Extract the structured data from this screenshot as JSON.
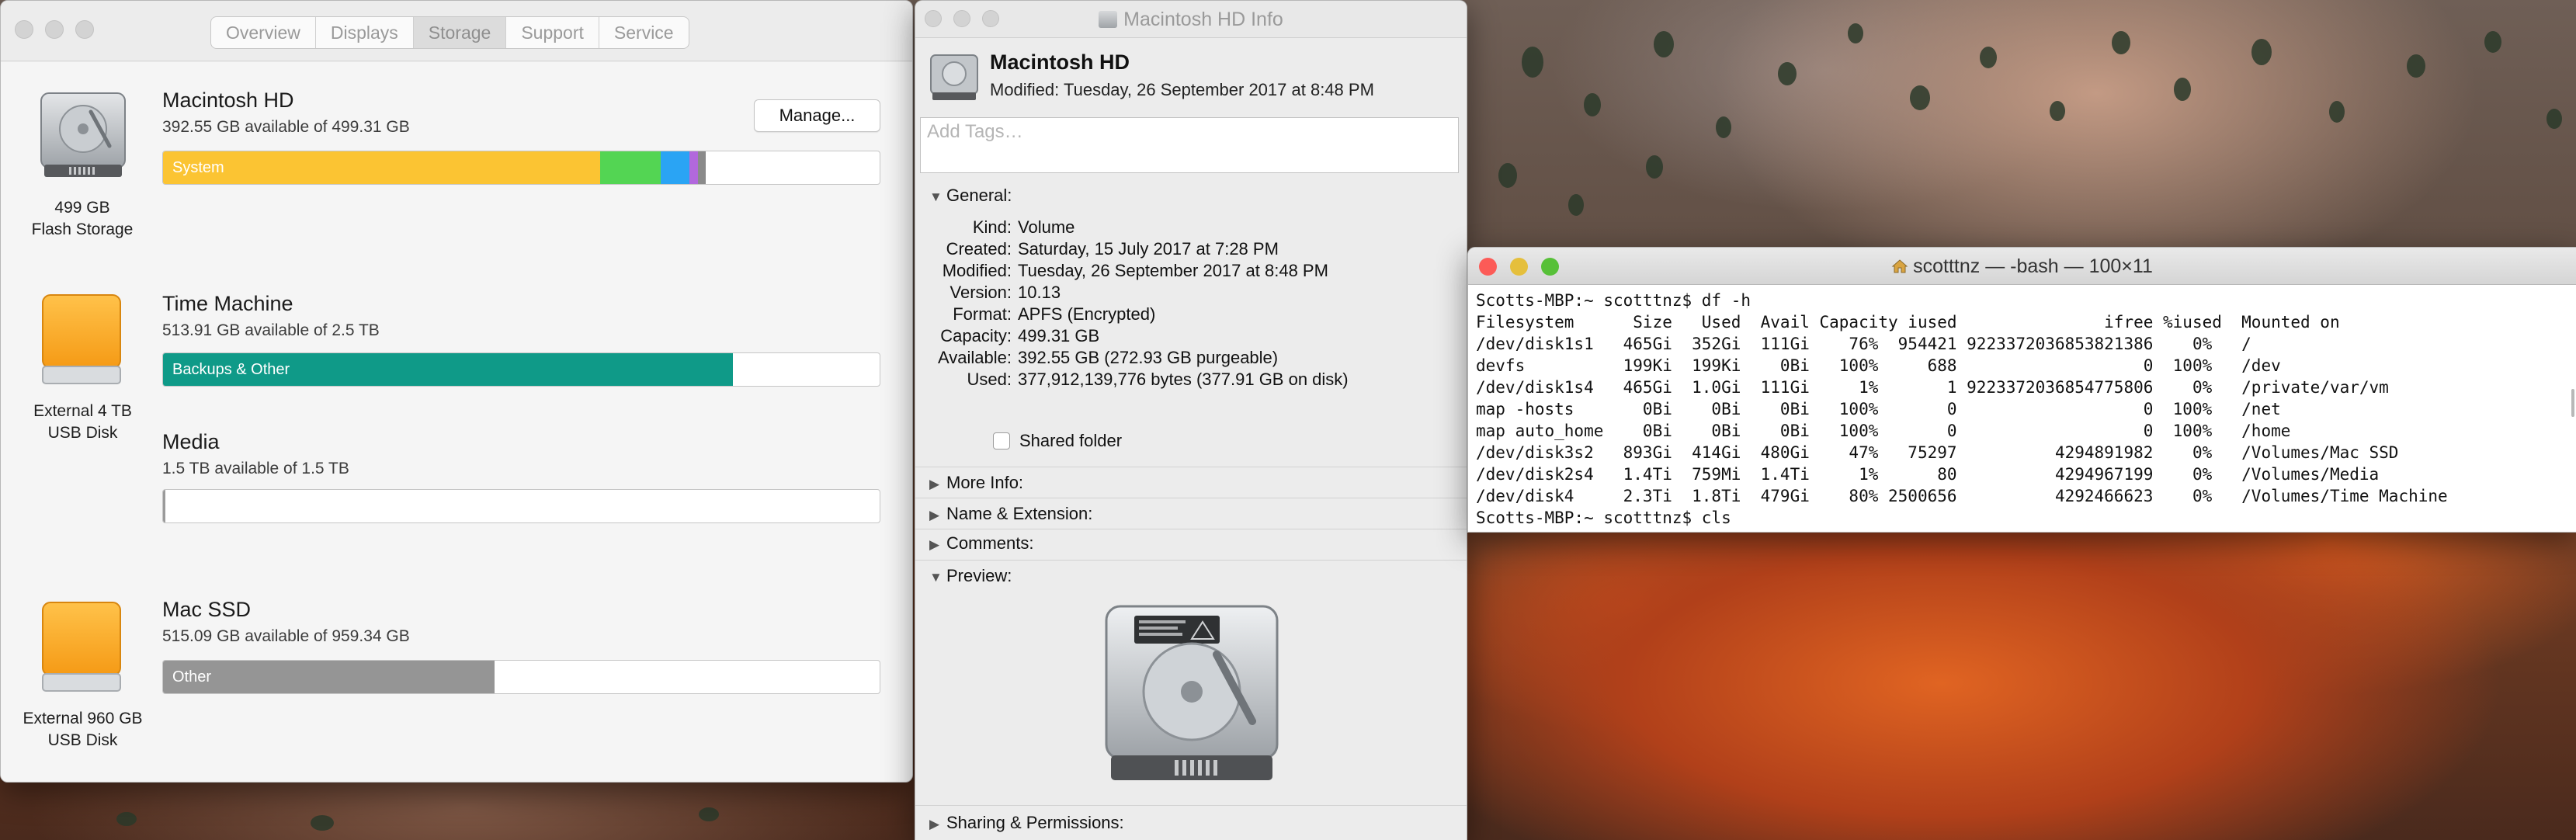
{
  "about": {
    "tabs": [
      "Overview",
      "Displays",
      "Storage",
      "Support",
      "Service"
    ],
    "active_tab": "Storage",
    "drives": [
      {
        "name": "Macintosh HD",
        "available": "392.55 GB available of 499.31 GB",
        "cap_line1": "499 GB",
        "cap_line2": "Flash Storage",
        "manage_label": "Manage...",
        "segments": [
          {
            "label": "System",
            "fraction": 0.61,
            "color": "#fbc433"
          },
          {
            "label": "",
            "fraction": 0.085,
            "color": "#53d553"
          },
          {
            "label": "",
            "fraction": 0.04,
            "color": "#2aa4f4"
          },
          {
            "label": "",
            "fraction": 0.012,
            "color": "#b268dd"
          },
          {
            "label": "",
            "fraction": 0.01,
            "color": "#8a8a8a"
          }
        ]
      },
      {
        "name": "Time Machine",
        "available": "513.91 GB available of 2.5 TB",
        "cap_line1": "External 4 TB",
        "cap_line2": "USB Disk",
        "segments": [
          {
            "label": "Backups & Other",
            "fraction": 0.795,
            "color": "#0f9a88"
          }
        ]
      },
      {
        "name": "Media",
        "available": "1.5 TB available of 1.5 TB",
        "segments": [
          {
            "label": "",
            "fraction": 0.003,
            "color": "#9a9a9a"
          }
        ]
      },
      {
        "name": "Mac SSD",
        "available": "515.09 GB available of 959.34 GB",
        "cap_line1": "External 960 GB",
        "cap_line2": "USB Disk",
        "segments": [
          {
            "label": "Other",
            "fraction": 0.463,
            "color": "#959595"
          }
        ]
      }
    ]
  },
  "info": {
    "window_title": "Macintosh HD Info",
    "name": "Macintosh HD",
    "modified_header": "Modified: Tuesday, 26 September 2017 at 8:48 PM",
    "tags_placeholder": "Add Tags…",
    "general_label": "General:",
    "general": [
      {
        "k": "Kind:",
        "v": "Volume"
      },
      {
        "k": "Created:",
        "v": "Saturday, 15 July 2017 at 7:28 PM"
      },
      {
        "k": "Modified:",
        "v": "Tuesday, 26 September 2017 at 8:48 PM"
      },
      {
        "k": "Version:",
        "v": "10.13"
      },
      {
        "k": "Format:",
        "v": "APFS (Encrypted)"
      },
      {
        "k": "Capacity:",
        "v": "499.31 GB"
      },
      {
        "k": "Available:",
        "v": "392.55 GB (272.93 GB purgeable)"
      },
      {
        "k": "Used:",
        "v": "377,912,139,776 bytes (377.91 GB on disk)"
      }
    ],
    "shared_folder_label": "Shared folder",
    "more_info": "More Info:",
    "name_ext": "Name & Extension:",
    "comments": "Comments:",
    "preview": "Preview:",
    "sharing": "Sharing & Permissions:"
  },
  "terminal": {
    "title": "scotttnz — -bash — 100×11",
    "lines": [
      "Scotts-MBP:~ scotttnz$ df -h",
      "Filesystem      Size   Used  Avail Capacity iused               ifree %iused  Mounted on",
      "/dev/disk1s1   465Gi  352Gi  111Gi    76%  954421 9223372036853821386    0%   /",
      "devfs          199Ki  199Ki    0Bi   100%     688                   0  100%   /dev",
      "/dev/disk1s4   465Gi  1.0Gi  111Gi     1%       1 9223372036854775806    0%   /private/var/vm",
      "map -hosts       0Bi    0Bi    0Bi   100%       0                   0  100%   /net",
      "map auto_home    0Bi    0Bi    0Bi   100%       0                   0  100%   /home",
      "/dev/disk3s2   893Gi  414Gi  480Gi    47%   75297          4294891982    0%   /Volumes/Mac SSD",
      "/dev/disk2s4   1.4Ti  759Mi  1.4Ti     1%      80          4294967199    0%   /Volumes/Media",
      "/dev/disk4     2.3Ti  1.8Ti  479Gi    80% 2500656          4292466623    0%   /Volumes/Time Machine",
      "Scotts-MBP:~ scotttnz$ cls"
    ]
  }
}
